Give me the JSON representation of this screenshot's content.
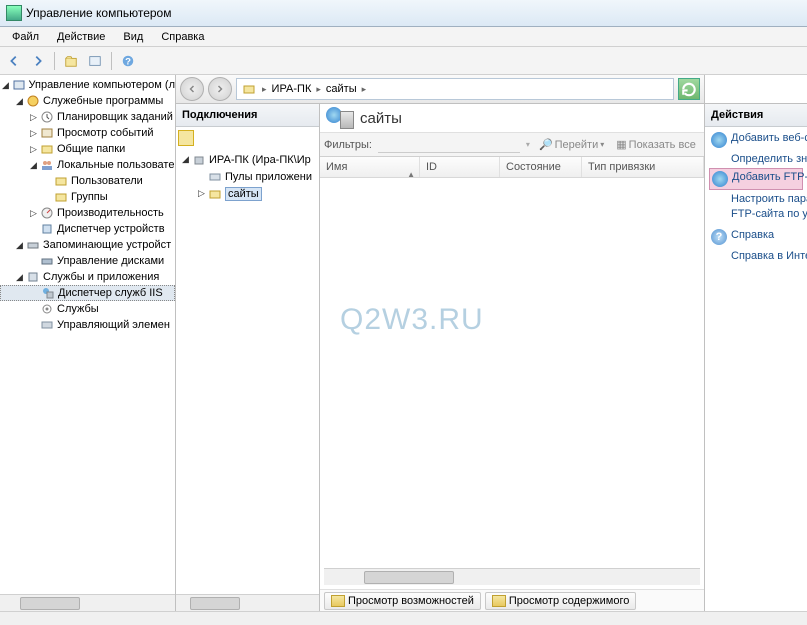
{
  "title": "Управление компьютером",
  "menu": [
    "Файл",
    "Действие",
    "Вид",
    "Справка"
  ],
  "tree": {
    "root": "Управление компьютером (л",
    "svc": "Служебные программы",
    "sched": "Планировщик заданий",
    "events": "Просмотр событий",
    "shared": "Общие папки",
    "users": "Локальные пользовате",
    "users_sub": "Пользователи",
    "groups": "Группы",
    "perf": "Производительность",
    "devmgr": "Диспетчер устройств",
    "storage": "Запоминающие устройст",
    "diskmgr": "Управление дисками",
    "svcapps": "Службы и приложения",
    "iis": "Диспетчер служб IIS",
    "services": "Службы",
    "wmi": "Управляющий элемен"
  },
  "breadcrumb": {
    "host": "ИРА-ПК",
    "sites": "сайты"
  },
  "conn": {
    "title": "Подключения",
    "host": "ИРА-ПК (Ира-ПК\\Ир",
    "pools": "Пулы приложени",
    "sites": "сайты"
  },
  "content": {
    "title": "сайты",
    "filter_label": "Фильтры:",
    "go": "Перейти",
    "showall": "Показать все",
    "col_name": "Имя",
    "col_id": "ID",
    "col_state": "Состояние",
    "col_binding": "Тип привязки",
    "watermark": "Q2W3.RU",
    "tab_features": "Просмотр возможностей",
    "tab_content": "Просмотр содержимого"
  },
  "actions": {
    "title": "Действия",
    "add_web": "Добавить веб-са",
    "web_defaults": "Определить знач умолчанию для",
    "add_ftp": "Добавить FTP-са",
    "ftp_defaults1": "Настроить парам",
    "ftp_defaults2": "FTP-сайта по умо",
    "help": "Справка",
    "help_online": "Справка в Интер"
  }
}
